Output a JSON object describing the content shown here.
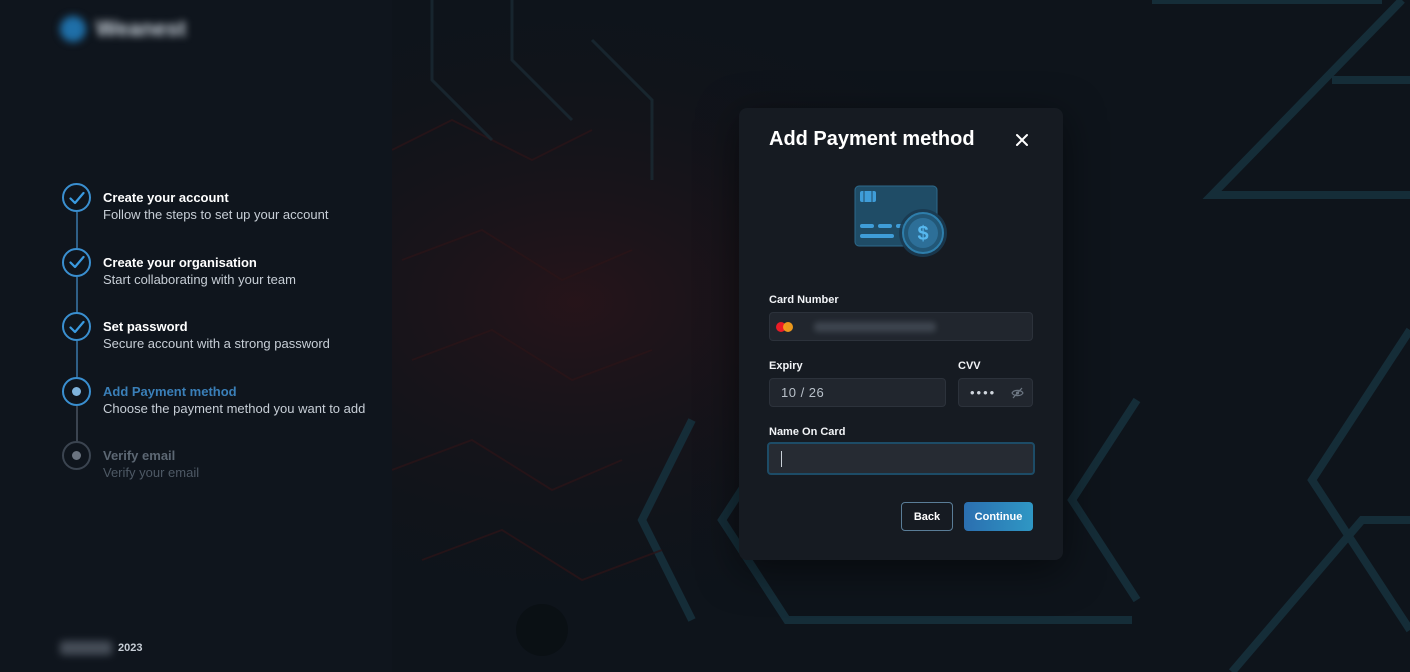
{
  "brand": {
    "name": "Weanest",
    "year": "2023"
  },
  "steps": [
    {
      "title": "Create your account",
      "subtitle": "Follow the steps to set up your account",
      "status": "complete"
    },
    {
      "title": "Create your organisation",
      "subtitle": "Start collaborating with your team",
      "status": "complete"
    },
    {
      "title": "Set password",
      "subtitle": "Secure account with a strong password",
      "status": "complete"
    },
    {
      "title": "Add Payment method",
      "subtitle": "Choose the payment method you want to add",
      "status": "current"
    },
    {
      "title": "Verify email",
      "subtitle": "Verify your email",
      "status": "upcoming"
    }
  ],
  "modal": {
    "title": "Add Payment method",
    "card_number": {
      "label": "Card Number",
      "value": "",
      "brand_icon": "mastercard-icon"
    },
    "expiry": {
      "label": "Expiry",
      "value": "10 / 26"
    },
    "cvv": {
      "label": "CVV",
      "value": "••••"
    },
    "name_on_card": {
      "label": "Name On Card",
      "value": ""
    },
    "back_label": "Back",
    "continue_label": "Continue"
  },
  "colors": {
    "accent": "#2f8fc9",
    "background": "#0c1118",
    "panel": "#161b22"
  }
}
